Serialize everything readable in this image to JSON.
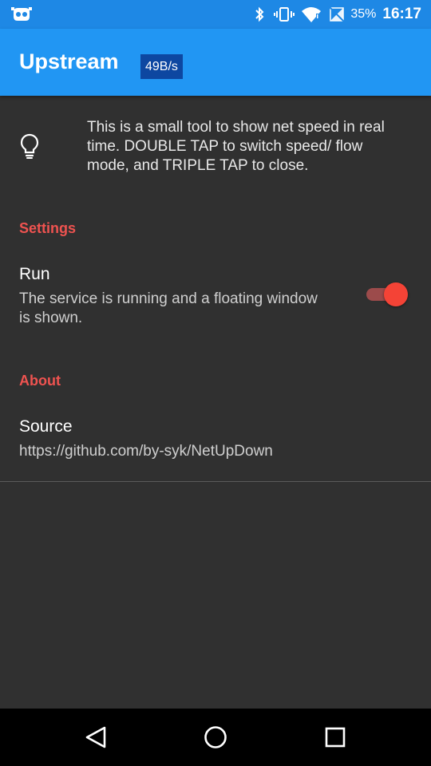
{
  "status_bar": {
    "battery_percent": "35%",
    "time": "16:17",
    "icons": [
      "cyanogen-mascot-icon",
      "bluetooth-icon",
      "vibrate-icon",
      "wifi-icon",
      "no-sim-icon",
      "battery-icon"
    ]
  },
  "app_bar": {
    "title": "Upstream",
    "speed": "49B/s"
  },
  "intro": {
    "icon": "lightbulb-icon",
    "text": "This is a small tool to show net speed in real time. DOUBLE TAP to switch speed/ flow mode, and TRIPLE TAP to close."
  },
  "settings": {
    "header": "Settings",
    "run": {
      "title": "Run",
      "summary": "The service is running and a floating window is shown.",
      "enabled": true
    }
  },
  "about": {
    "header": "About",
    "source": {
      "title": "Source",
      "summary": "https://github.com/by-syk/NetUpDown"
    }
  },
  "nav_bar": {
    "icons": [
      "back-icon",
      "home-icon",
      "recents-icon"
    ]
  },
  "colors": {
    "status_bar": "#1E88E5",
    "app_bar": "#2196F3",
    "speed_badge": "#0D47A1",
    "background": "#303030",
    "accent": "#EF5350"
  }
}
